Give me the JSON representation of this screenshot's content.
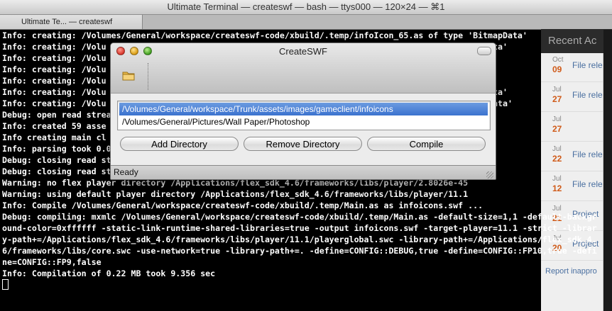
{
  "terminal": {
    "window_title": "Ultimate Terminal — createswf — bash — ttys000 — 120×24 — ⌘1",
    "tab_label": "Ultimate Te... — createswf",
    "lines": [
      "Info: creating: /Volumes/General/workspace/createswf-code/xbuild/.temp/infoIcon_65.as of type 'BitmapData'",
      "Info: creating: /Volu                                                                          apData'",
      "Info: creating: /Volu                                                                         Data'",
      "Info: creating: /Volu                                                                         Data'",
      "Info: creating: /Volu                                                                         Data'",
      "Info: creating: /Volu                                                                 ype 'BitmapData'",
      "Info: creating: /Volu                                                                 type 'BitmapData'",
      "Debug: open read strea                                                                 mapData'",
      "Info: created 59 asse",
      "Info creating main cl",
      "Info: parsing took 0.0",
      "Debug: closing read st",
      "Debug: closing read stream :Main.as",
      "Warning: no flex player directory /Applications/flex_sdk_4.6/frameworks/libs/player/2.8026e-45",
      "Warning: using default player directory /Applications/flex_sdk_4.6/frameworks/libs/player/11.1",
      "Info: Compile /Volumes/General/workspace/createswf-code/xbuild/.temp/Main.as as infoicons.swf ...",
      "Debug: compiling: mxmlc /Volumes/General/workspace/createswf-code/xbuild/.temp/Main.as -default-size=1,1 -default-backgr",
      "ound-color=0xffffff -static-link-runtime-shared-libraries=true -output infoicons.swf -target-player=11.1 -strict -librar",
      "y-path+=/Applications/flex_sdk_4.6/frameworks/libs/player/11.1/playerglobal.swc -library-path+=/Applications/flex_sdk_4.",
      "6/frameworks/libs/core.swc -use-network=true -library-path+=. -define=CONFIG::DEBUG,true -define=CONFIG::FP10,true -defi",
      "ne=CONFIG::FP9,false",
      "Info: Compilation of 0.22 MB took 9.356 sec"
    ]
  },
  "dialog": {
    "title": "CreateSWF",
    "directories": [
      "/Volumes/General/workspace/Trunk/assets/images/gameclient/infoicons",
      "/Volumes/General/Pictures/Wall Paper/Photoshop"
    ],
    "buttons": {
      "add": "Add Directory",
      "remove": "Remove Directory",
      "compile": "Compile"
    },
    "status": "Ready",
    "selection_color": "#3b72cf"
  },
  "background_app": {
    "header": "Recent Ac",
    "activities": [
      {
        "month": "Oct",
        "day": "09",
        "text": "File rele"
      },
      {
        "month": "Jul",
        "day": "27",
        "text": "File rele"
      },
      {
        "month": "Jul",
        "day": "27",
        "text": ""
      },
      {
        "month": "Jul",
        "day": "22",
        "text": "File rele"
      },
      {
        "month": "Jul",
        "day": "12",
        "text": "File rele"
      },
      {
        "month": "Jul",
        "day": "21",
        "text": "Project"
      },
      {
        "month": "Jul",
        "day": "20",
        "text": "Project"
      }
    ],
    "report": "Report inappro",
    "accent_color": "#d05a18"
  }
}
